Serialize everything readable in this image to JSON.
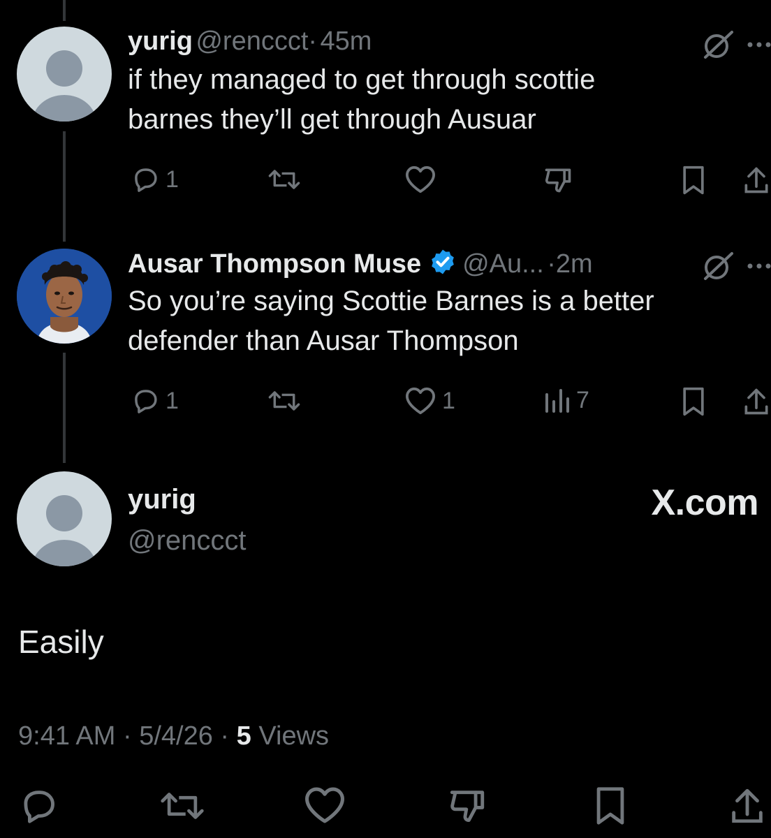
{
  "tweets": [
    {
      "name": "yurig",
      "handle": "@renccct",
      "separator": "·",
      "time": "45m",
      "text_line1": "if they managed to get through scottie",
      "text_line2": "barnes they’ll get through Ausuar",
      "reply_count": "1",
      "like_count": "",
      "views_count": ""
    },
    {
      "name": "Ausar Thompson Muse",
      "verified": true,
      "handle": "@Au...",
      "separator": "·",
      "time": "2m",
      "text_line1": "So you’re saying Scottie Barnes is a better",
      "text_line2": "defender than Ausar Thompson",
      "reply_count": "1",
      "like_count": "1",
      "views_count": "7"
    }
  ],
  "main_tweet": {
    "name": "yurig",
    "handle": "@renccct",
    "text": "Easily",
    "time": "9:41 AM",
    "separator": "·",
    "date": "5/4/26",
    "views_count": "5",
    "views_label": "Views"
  },
  "watermark": "X.com",
  "colors": {
    "background": "#000000",
    "text": "#e7e9ea",
    "muted": "#71767b",
    "verified_blue": "#1d9bf0",
    "thread_line": "#333639"
  }
}
